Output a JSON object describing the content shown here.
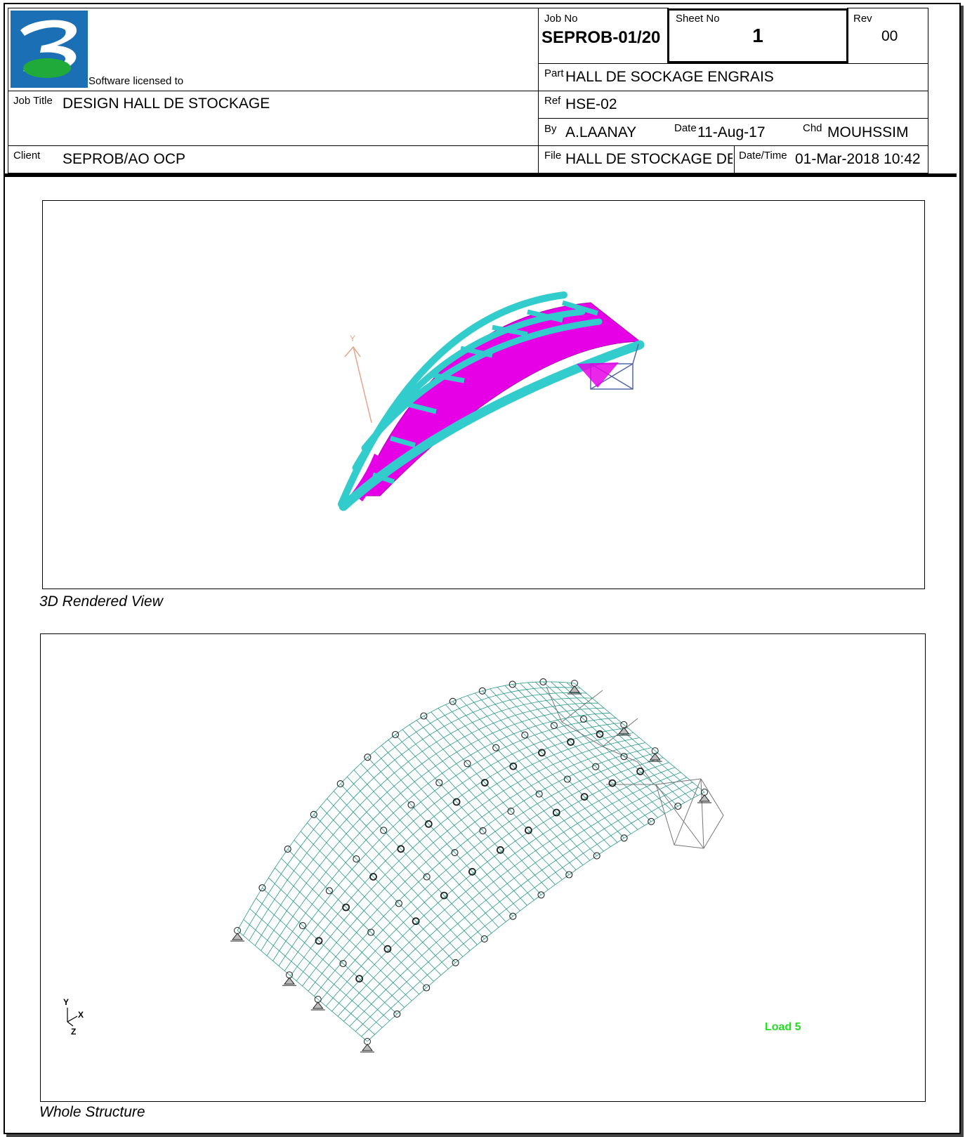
{
  "header": {
    "licensed_label": "Software licensed to",
    "job_no_label": "Job No",
    "job_no": "SEPROB-01/20",
    "sheet_no_label": "Sheet No",
    "sheet_no": "1",
    "rev_label": "Rev",
    "rev": "00",
    "part_label": "Part",
    "part": "HALL DE SOCKAGE ENGRAIS",
    "job_title_label": "Job Title",
    "job_title": "DESIGN HALL DE STOCKAGE",
    "ref_label": "Ref",
    "ref": "HSE-02",
    "by_label": "By",
    "by": "A.LAANAY",
    "date_label": "Date",
    "date": "11-Aug-17",
    "chd_label": "Chd",
    "chd": "MOUHSSIM",
    "client_label": "Client",
    "client": "SEPROB/AO OCP",
    "file_label": "File",
    "file": "HALL DE STOCKAGE DE",
    "datetime_label": "Date/Time",
    "datetime": "01-Mar-2018 10:42"
  },
  "views": {
    "rendered_caption": "3D Rendered View",
    "rendered_axis_label": "Y",
    "whole_caption": "Whole Structure",
    "axis_y": "Y",
    "axis_x": "X",
    "axis_z": "Z",
    "load_label": "Load 5"
  },
  "colors": {
    "beam": "#33cccc",
    "panel": "#e600e6",
    "mesh": "#2a9a8a",
    "load": "#22dd22"
  },
  "icons": [
    "company-logo-icon",
    "support-icon",
    "node-circle-icon",
    "axis-triad-icon"
  ]
}
